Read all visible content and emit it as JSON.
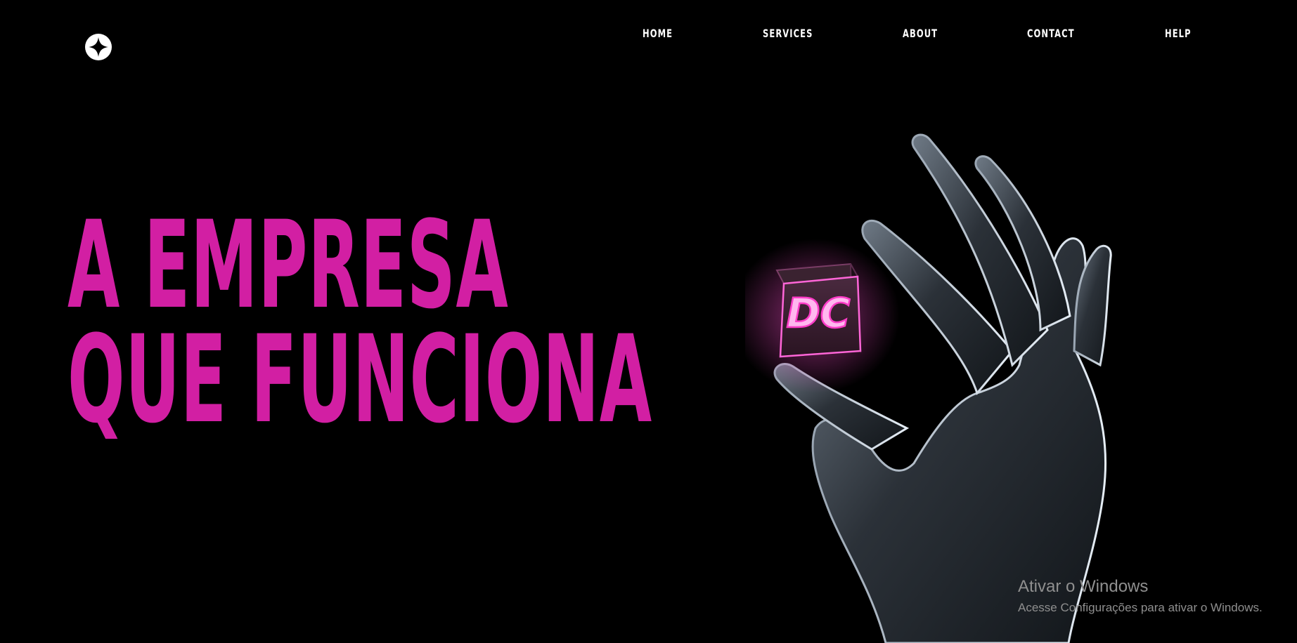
{
  "nav": {
    "items": [
      {
        "label": "HOME"
      },
      {
        "label": "SERVICES"
      },
      {
        "label": "ABOUT"
      },
      {
        "label": "CONTACT"
      },
      {
        "label": "HELP"
      }
    ]
  },
  "hero": {
    "title_line1": "A EMPRESA",
    "title_line2": "QUE FUNCIONA",
    "accent_color": "#d21fa3",
    "cube_label": "DC"
  },
  "windows_watermark": {
    "title": "Ativar o Windows",
    "subtitle": "Acesse Configurações para ativar o Windows."
  },
  "colors": {
    "background": "#000000",
    "nav_text": "#ffffff",
    "accent": "#d21fa3"
  }
}
